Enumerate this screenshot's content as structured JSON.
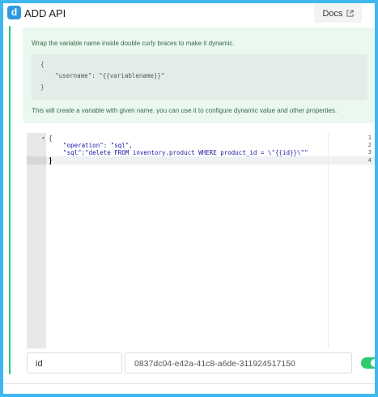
{
  "header": {
    "logo_letter": "d",
    "title": "ADD API",
    "docs_label": "Docs"
  },
  "info": {
    "line1": "Wrap the variable name inside double curly braces to make it dynamic.",
    "sample": [
      "{",
      "    \"username\": \"{{variablename}}\"",
      "}"
    ],
    "line2": "This will create a variable with given name. you can use it to configure dynamic value and other properties."
  },
  "editor": {
    "line_numbers": [
      "1",
      "2",
      "3",
      "4"
    ],
    "lines": [
      "{",
      "    \"operation\": \"sql\",",
      "    \"sql\":\"delete FROM inventory.product WHERE product_id = \\\"{{id}}\\\"\"",
      "}"
    ],
    "active_line": "4"
  },
  "variable": {
    "key": "id",
    "value": "0837dc04-e42a-41c8-a6de-311924517150",
    "enabled": true
  },
  "colors": {
    "accent_blue": "#2f9ae0",
    "green": "#2ecc71",
    "info_bg": "#eaf8ef"
  }
}
